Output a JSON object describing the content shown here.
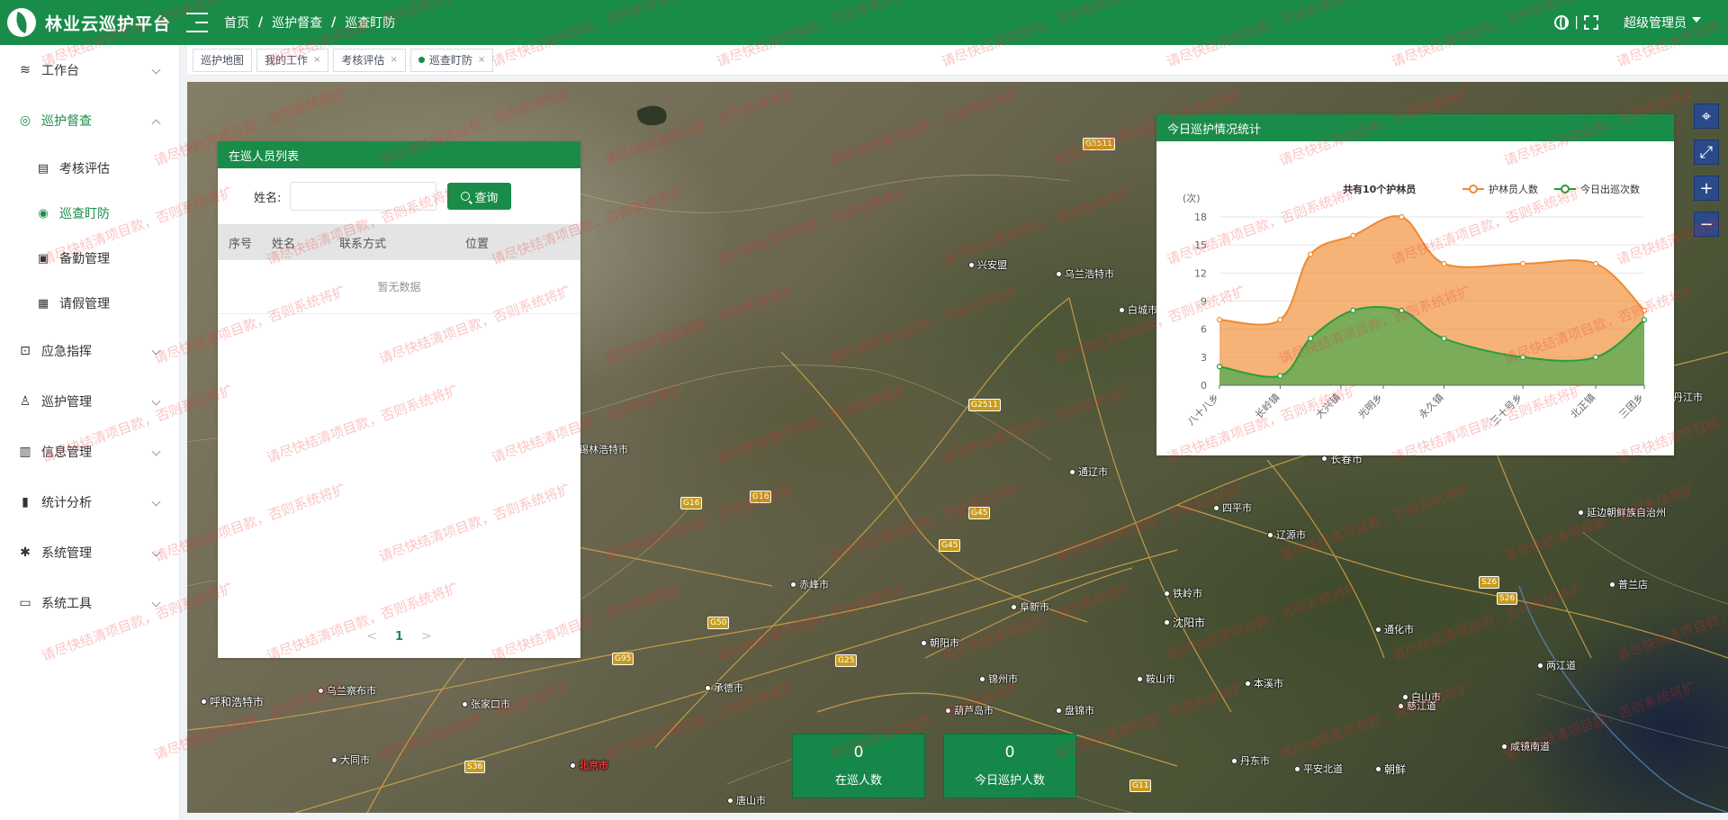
{
  "header": {
    "app_title": "林业云巡护平台",
    "breadcrumb": [
      "首页",
      "巡护督查",
      "巡查盯防"
    ],
    "user_name": "超级管理员",
    "divider": "|"
  },
  "sidebar": {
    "items": [
      {
        "label": "工作台",
        "icon": "layers-icon"
      },
      {
        "label": "巡护督查",
        "icon": "dashboard-icon",
        "children": [
          {
            "label": "考核评估",
            "icon": "chart-icon"
          },
          {
            "label": "巡查盯防",
            "icon": "eye-icon"
          },
          {
            "label": "备勤管理",
            "icon": "briefcase-icon"
          },
          {
            "label": "请假管理",
            "icon": "calendar-icon"
          }
        ]
      },
      {
        "label": "应急指挥",
        "icon": "alert-icon"
      },
      {
        "label": "巡护管理",
        "icon": "user-icon"
      },
      {
        "label": "信息管理",
        "icon": "info-icon"
      },
      {
        "label": "统计分析",
        "icon": "bar-chart-icon"
      },
      {
        "label": "系统管理",
        "icon": "gear-icon"
      },
      {
        "label": "系统工具",
        "icon": "toolbox-icon"
      }
    ]
  },
  "tabs": [
    {
      "label": "巡护地图",
      "closable": false
    },
    {
      "label": "我的工作",
      "closable": true
    },
    {
      "label": "考核评估",
      "closable": true
    },
    {
      "label": "巡查盯防",
      "closable": true,
      "active": true
    }
  ],
  "patrol_list": {
    "title": "在巡人员列表",
    "search_label": "姓名:",
    "search_value": "",
    "search_button": "查询",
    "columns": [
      "序号",
      "姓名",
      "联系方式",
      "位置"
    ],
    "empty_text": "暂无数据",
    "pager": {
      "prev": "<",
      "current": "1",
      "next": ">"
    }
  },
  "stats": {
    "title": "今日巡护情况统计",
    "summary": "共有10个护林员",
    "unit": "(次)"
  },
  "chart_data": {
    "type": "area",
    "categories": [
      "八十八乡",
      "长岭镇",
      "大兴镇",
      "光明乡",
      "永久镇",
      "三十号乡",
      "北正镇",
      "三团乡"
    ],
    "x": [
      0,
      1,
      2,
      2.7,
      3.7,
      5,
      6.2,
      7
    ],
    "series": [
      {
        "name": "护林员人数",
        "color": "#f08a30",
        "x": [
          0,
          1,
          1.5,
          2.2,
          3,
          3.7,
          5,
          6.2,
          7
        ],
        "values": [
          7,
          7,
          14,
          16,
          18,
          13,
          13,
          13,
          8
        ]
      },
      {
        "name": "今日出巡次数",
        "color": "#2a9d3c",
        "x": [
          0,
          1,
          1.5,
          2.2,
          3,
          3.7,
          5,
          6.2,
          7
        ],
        "values": [
          2,
          1,
          5,
          8,
          8,
          5,
          3,
          3,
          7
        ]
      }
    ],
    "ylim": [
      0,
      18
    ],
    "yticks": [
      0,
      3,
      6,
      9,
      12,
      15,
      18
    ],
    "legend_position": "top-right"
  },
  "bottom_stats": [
    {
      "value": "0",
      "label": "在巡人数"
    },
    {
      "value": "0",
      "label": "今日巡护人数"
    }
  ],
  "map": {
    "labels": [
      "兴安盟",
      "乌兰浩特市",
      "白城市",
      "锡林浩特市",
      "通辽市",
      "四平市",
      "辽源市",
      "长春市",
      "延边朝鲜族自治州",
      "赤峰市",
      "阜新市",
      "铁岭市",
      "沈阳市",
      "通化市",
      "朝阳市",
      "锦州市",
      "鞍山市",
      "本溪市",
      "承德市",
      "葫芦岛市",
      "盘锦市",
      "丹东市",
      "白山市",
      "呼和浩特市",
      "乌兰察布市",
      "张家口市",
      "大同市",
      "北京市",
      "唐山市",
      "平安北道",
      "朝鲜",
      "慈江道",
      "两江道",
      "咸镜南道",
      "牡丹江市",
      "普兰店"
    ],
    "highways": [
      "G5511",
      "G2511",
      "G16",
      "G16",
      "G45",
      "G45",
      "G50",
      "G95",
      "G25",
      "S36",
      "S26",
      "S26",
      "G11"
    ]
  },
  "watermark": "请尽快结清项目款，否则系统将扩"
}
